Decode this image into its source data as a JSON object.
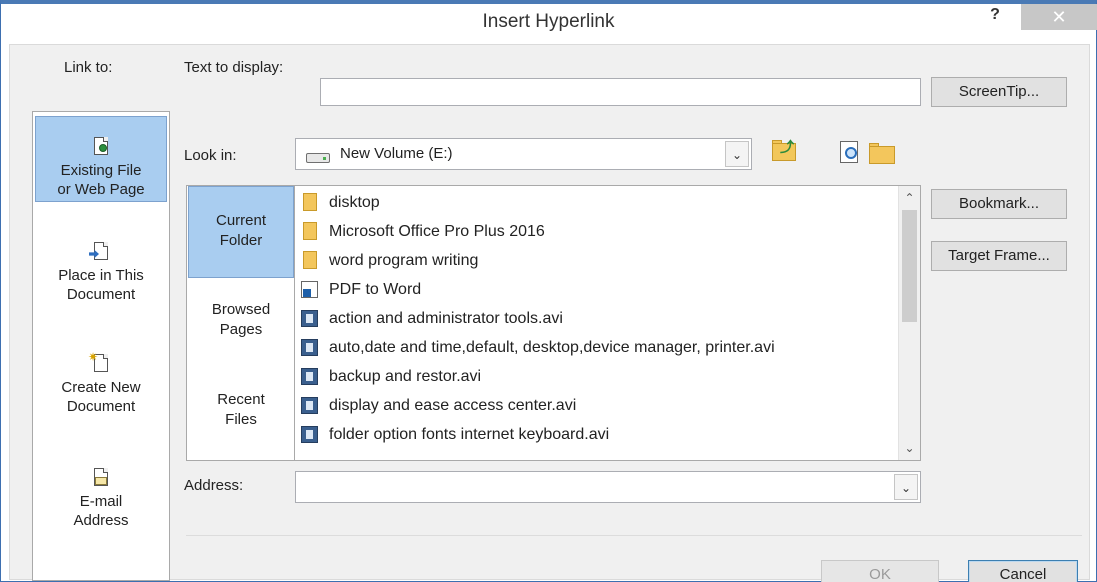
{
  "window": {
    "title": "Insert Hyperlink",
    "help_label": "?",
    "close_label": "✕"
  },
  "link_to": {
    "label": "Link to:",
    "items": [
      {
        "line1": "Existing File",
        "line2": "or Web Page",
        "icon": "web-page-icon",
        "selected": true
      },
      {
        "line1": "Place in This",
        "line2": "Document",
        "icon": "place-in-document-icon",
        "selected": false
      },
      {
        "line1": "Create New",
        "line2": "Document",
        "icon": "new-document-icon",
        "selected": false
      },
      {
        "line1": "E-mail",
        "line2": "Address",
        "icon": "email-icon",
        "selected": false
      }
    ]
  },
  "text_to_display": {
    "label": "Text to display:",
    "value": ""
  },
  "screentip_button": "ScreenTip...",
  "look_in": {
    "label": "Look in:",
    "value": "New Volume (E:)",
    "icon": "drive-icon",
    "arrow": "⌄"
  },
  "places": [
    {
      "line1": "Current",
      "line2": "Folder",
      "selected": true
    },
    {
      "line1": "Browsed",
      "line2": "Pages",
      "selected": false
    },
    {
      "line1": "Recent",
      "line2": "Files",
      "selected": false
    }
  ],
  "files": [
    {
      "name": "disktop",
      "type": "folder"
    },
    {
      "name": "Microsoft Office Pro Plus 2016",
      "type": "folder"
    },
    {
      "name": "word program writing",
      "type": "folder"
    },
    {
      "name": "PDF to Word",
      "type": "shortcut"
    },
    {
      "name": "action and administrator tools.avi",
      "type": "video"
    },
    {
      "name": "auto,date and time,default, desktop,device manager, printer.avi",
      "type": "video"
    },
    {
      "name": "backup and restor.avi",
      "type": "video"
    },
    {
      "name": "display and ease access center.avi",
      "type": "video"
    },
    {
      "name": "folder option fonts internet keyboard.avi",
      "type": "video"
    }
  ],
  "scroll": {
    "up": "⌃",
    "down": "⌄"
  },
  "right_buttons": {
    "bookmark": "Bookmark...",
    "target_frame": "Target Frame..."
  },
  "address": {
    "label": "Address:",
    "value": "",
    "arrow": "⌄"
  },
  "footer": {
    "ok": "OK",
    "cancel": "Cancel"
  },
  "colors": {
    "selection": "#a9cdf0",
    "frame": "#4a7ab5"
  }
}
